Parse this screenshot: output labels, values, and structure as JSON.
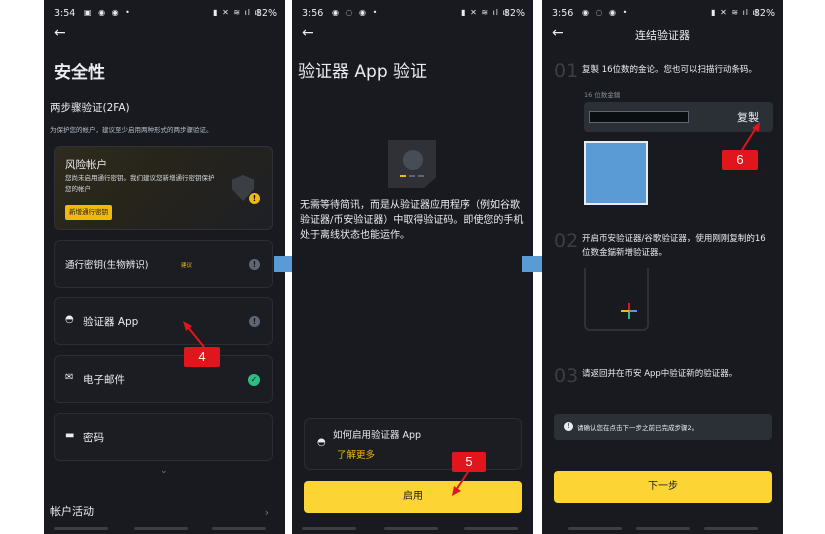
{
  "colors": {
    "accent": "#fcd535",
    "annotation": "#e0161c",
    "arrow": "#5b9bd5",
    "background": "#181a20"
  },
  "panel1": {
    "status": {
      "time": "3:54",
      "battery": "82%"
    },
    "title": "安全性",
    "section": "两步骤验证(2FA)",
    "section_desc": "为保护您的帐户，建议至少启用两种形式的两步骤验证。",
    "risk": {
      "title": "风险帐户",
      "desc": "您尚未启用通行密钥。我们建议您新增通行密钥保护您的帐户",
      "button": "新增通行密钥"
    },
    "items": [
      {
        "label": "通行密钥(生物辨识)",
        "tag": "建议",
        "icon": "info-icon"
      },
      {
        "label": "验证器 App",
        "icon": "info-icon"
      },
      {
        "label": "电子邮件",
        "icon": "check-icon"
      },
      {
        "label": "密码"
      }
    ],
    "activity": "帐户活动",
    "annotation": "4"
  },
  "panel2": {
    "status": {
      "time": "3:56",
      "battery": "82%"
    },
    "title": "验证器 App 验证",
    "body": "无需等待简讯，而是从验证器应用程序（例如谷歌验证器/币安验证器）中取得验证码。即使您的手机处于离线状态也能运作。",
    "how_title": "如何启用验证器 App",
    "how_link": "了解更多",
    "enable_button": "启用",
    "annotation": "5"
  },
  "panel3": {
    "status": {
      "time": "3:56",
      "battery": "82%"
    },
    "title": "连结验证器",
    "steps": [
      {
        "num": "01",
        "text": "复製 16位数的金论。您也可以扫描行动条码。"
      },
      {
        "num": "02",
        "text": "开启币安验证器/谷歌验证器，使用刚刚复制的16 位数金鍴新增验证器。"
      },
      {
        "num": "03",
        "text": "请返回并在币安 App中验证新的验证器。"
      }
    ],
    "key_label": "16 位数金鑰",
    "copy": "复製",
    "note": "请确认您在点击下一步之前已完成步骤2。",
    "next_button": "下一步",
    "annotation": "6"
  }
}
